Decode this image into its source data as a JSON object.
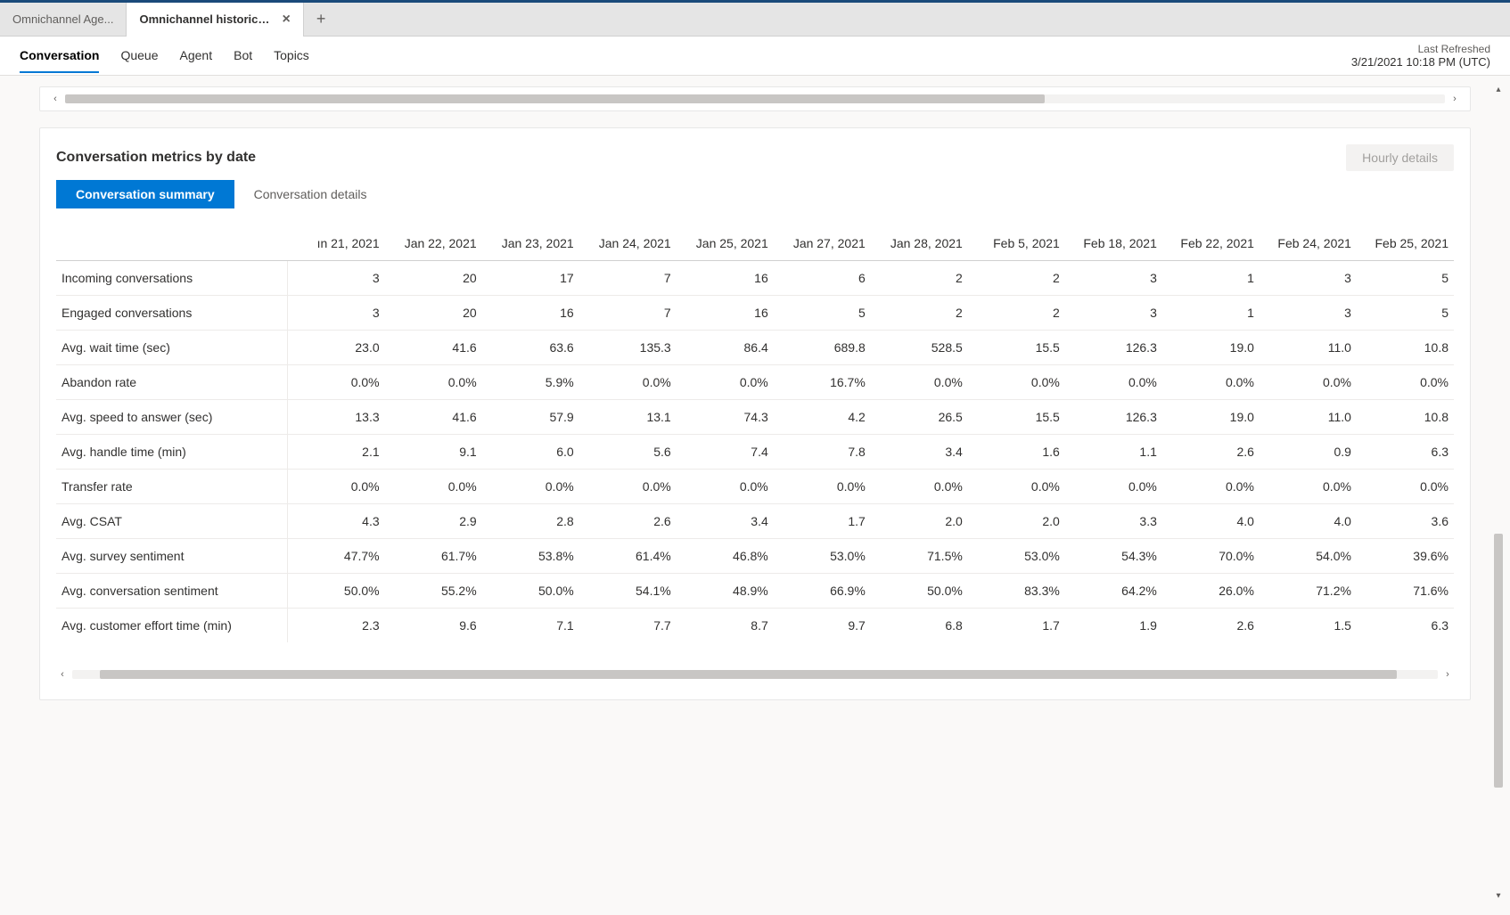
{
  "tabs": [
    {
      "title": "Omnichannel Age...",
      "active": false
    },
    {
      "title": "Omnichannel historical an...",
      "active": true
    }
  ],
  "nav": {
    "items": [
      "Conversation",
      "Queue",
      "Agent",
      "Bot",
      "Topics"
    ],
    "active_index": 0,
    "refresh_label": "Last Refreshed",
    "refresh_value": "3/21/2021 10:18 PM (UTC)"
  },
  "card": {
    "title": "Conversation metrics by date",
    "hourly_button": "Hourly details",
    "pills": [
      "Conversation summary",
      "Conversation details"
    ],
    "active_pill": 0
  },
  "table": {
    "first_col_header": "",
    "date_headers": [
      "ın 21, 2021",
      "Jan 22, 2021",
      "Jan 23, 2021",
      "Jan 24, 2021",
      "Jan 25, 2021",
      "Jan 27, 2021",
      "Jan 28, 2021",
      "Feb 5, 2021",
      "Feb 18, 2021",
      "Feb 22, 2021",
      "Feb 24, 2021",
      "Feb 25, 2021"
    ],
    "rows": [
      {
        "metric": "Incoming conversations",
        "values": [
          "3",
          "20",
          "17",
          "7",
          "16",
          "6",
          "2",
          "2",
          "3",
          "1",
          "3",
          "5"
        ]
      },
      {
        "metric": "Engaged conversations",
        "values": [
          "3",
          "20",
          "16",
          "7",
          "16",
          "5",
          "2",
          "2",
          "3",
          "1",
          "3",
          "5"
        ]
      },
      {
        "metric": "Avg. wait time (sec)",
        "values": [
          "23.0",
          "41.6",
          "63.6",
          "135.3",
          "86.4",
          "689.8",
          "528.5",
          "15.5",
          "126.3",
          "19.0",
          "11.0",
          "10.8"
        ]
      },
      {
        "metric": "Abandon rate",
        "values": [
          "0.0%",
          "0.0%",
          "5.9%",
          "0.0%",
          "0.0%",
          "16.7%",
          "0.0%",
          "0.0%",
          "0.0%",
          "0.0%",
          "0.0%",
          "0.0%"
        ]
      },
      {
        "metric": "Avg. speed to answer (sec)",
        "values": [
          "13.3",
          "41.6",
          "57.9",
          "13.1",
          "74.3",
          "4.2",
          "26.5",
          "15.5",
          "126.3",
          "19.0",
          "11.0",
          "10.8"
        ]
      },
      {
        "metric": "Avg. handle time (min)",
        "values": [
          "2.1",
          "9.1",
          "6.0",
          "5.6",
          "7.4",
          "7.8",
          "3.4",
          "1.6",
          "1.1",
          "2.6",
          "0.9",
          "6.3"
        ]
      },
      {
        "metric": "Transfer rate",
        "values": [
          "0.0%",
          "0.0%",
          "0.0%",
          "0.0%",
          "0.0%",
          "0.0%",
          "0.0%",
          "0.0%",
          "0.0%",
          "0.0%",
          "0.0%",
          "0.0%"
        ]
      },
      {
        "metric": "Avg. CSAT",
        "values": [
          "4.3",
          "2.9",
          "2.8",
          "2.6",
          "3.4",
          "1.7",
          "2.0",
          "2.0",
          "3.3",
          "4.0",
          "4.0",
          "3.6"
        ]
      },
      {
        "metric": "Avg. survey sentiment",
        "values": [
          "47.7%",
          "61.7%",
          "53.8%",
          "61.4%",
          "46.8%",
          "53.0%",
          "71.5%",
          "53.0%",
          "54.3%",
          "70.0%",
          "54.0%",
          "39.6%"
        ]
      },
      {
        "metric": "Avg. conversation sentiment",
        "values": [
          "50.0%",
          "55.2%",
          "50.0%",
          "54.1%",
          "48.9%",
          "66.9%",
          "50.0%",
          "83.3%",
          "64.2%",
          "26.0%",
          "71.2%",
          "71.6%"
        ]
      },
      {
        "metric": "Avg. customer effort time (min)",
        "values": [
          "2.3",
          "9.6",
          "7.1",
          "7.7",
          "8.7",
          "9.7",
          "6.8",
          "1.7",
          "1.9",
          "2.6",
          "1.5",
          "6.3"
        ]
      }
    ]
  }
}
